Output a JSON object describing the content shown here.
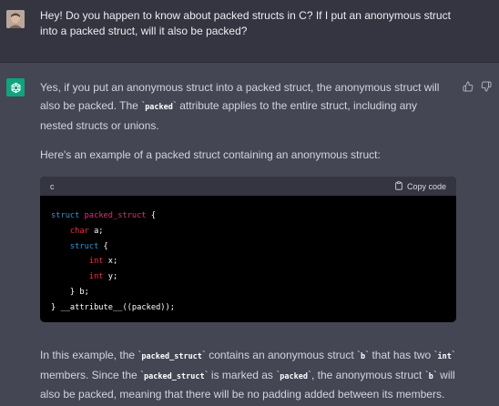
{
  "user_message": {
    "text": "Hey! Do you happen to know about packed structs in C? If I put an anonymous struct into a packed struct, will it also be packed?"
  },
  "assistant_message": {
    "para1_a": "Yes, if you put an anonymous struct into a packed struct, the anonymous struct will also be packed. The `",
    "para1_code": "packed",
    "para1_b": "` attribute applies to the entire struct, including any nested structs or unions.",
    "para2": "Here's an example of a packed struct containing an anonymous struct:",
    "code_block": {
      "language": "c",
      "copy_label": "Copy code",
      "lines": {
        "l1_kw": "struct",
        "l1_name": "packed_struct",
        "l1_rest": " {",
        "l2_type": "char",
        "l2_rest": " a;",
        "l3_kw": "struct",
        "l3_rest": " {",
        "l4_type": "int",
        "l4_rest": " x;",
        "l5_type": "int",
        "l5_rest": " y;",
        "l6": "} b;",
        "l7": "} __attribute__((packed));"
      }
    },
    "para3": {
      "t1": "In this example, the `",
      "c1": "packed_struct",
      "t2": "` contains an anonymous struct `",
      "c2": "b",
      "t3": "` that has two `",
      "c3": "int",
      "t4": "` members. Since the `",
      "c4": "packed_struct",
      "t5": "` is marked as `",
      "c5": "packed",
      "t6": "`, the anonymous struct `",
      "c6": "b",
      "t7": "` will also be packed, meaning that there will be no padding added between its members."
    }
  },
  "icons": {
    "user_avatar": "user-avatar-photo",
    "assistant_avatar": "openai-logo-icon",
    "like": "thumbs-up-icon",
    "dislike": "thumbs-down-icon",
    "copy": "clipboard-icon"
  },
  "colors": {
    "user_bg": "#343541",
    "assistant_bg": "#444654",
    "accent": "#10a37f",
    "code_bg": "#000000"
  }
}
